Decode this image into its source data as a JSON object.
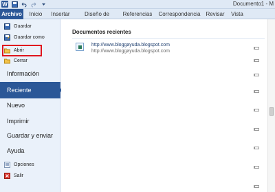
{
  "window": {
    "title": "Documento1 - M"
  },
  "titlebar": {
    "app_icon_letter": "W",
    "quick_access_icons": [
      "save-icon",
      "undo-icon",
      "redo-icon"
    ]
  },
  "ribbon": {
    "tabs": [
      "Archivo",
      "Inicio",
      "Insertar",
      "Diseño de página",
      "Referencias",
      "Correspondencia",
      "Revisar",
      "Vista"
    ],
    "active_tab": "Archivo",
    "active_tab_color": "#2b5797"
  },
  "backstage": {
    "items_small_top": [
      {
        "label": "Guardar",
        "icon": "save-icon"
      },
      {
        "label": "Guardar como",
        "icon": "save-as-icon"
      },
      {
        "label": "Abrir",
        "icon": "folder-icon"
      },
      {
        "label": "Cerrar",
        "icon": "close-document-icon"
      }
    ],
    "items_big": [
      {
        "label": "Información"
      },
      {
        "label": "Reciente"
      },
      {
        "label": "Nuevo"
      },
      {
        "label": "Imprimir"
      },
      {
        "label": "Guardar y enviar"
      },
      {
        "label": "Ayuda"
      }
    ],
    "items_small_bottom": [
      {
        "label": "Opciones",
        "icon": "options-icon"
      },
      {
        "label": "Salir",
        "icon": "exit-icon"
      }
    ],
    "selected": "Reciente",
    "highlighted": "Abrir",
    "highlight_color": "#e0141e"
  },
  "recent": {
    "title": "Documentos recientes",
    "documents": [
      {
        "name": "http://www.bloggayuda.blogspot.com",
        "path": "http://www.bloggayuda.blogspot.com"
      }
    ]
  }
}
